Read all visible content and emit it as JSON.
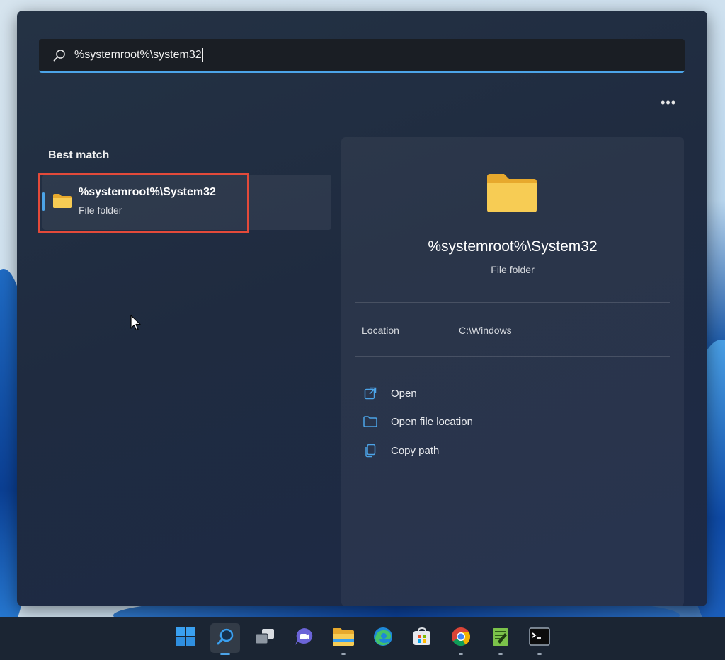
{
  "search": {
    "query": "%systemroot%\\system32",
    "icon": "search-icon"
  },
  "more_button": "•••",
  "best_match": {
    "heading": "Best match",
    "title": "%systemroot%\\System32",
    "subtitle": "File folder",
    "icon": "folder-icon"
  },
  "detail": {
    "title": "%systemroot%\\System32",
    "subtitle": "File folder",
    "location_label": "Location",
    "location_value": "C:\\Windows",
    "actions": [
      {
        "label": "Open",
        "icon": "open-external-icon"
      },
      {
        "label": "Open file location",
        "icon": "folder-outline-icon"
      },
      {
        "label": "Copy path",
        "icon": "copy-icon"
      }
    ]
  },
  "taskbar": {
    "items": [
      {
        "name": "start",
        "icon": "windows-logo-icon"
      },
      {
        "name": "search",
        "icon": "search-icon",
        "active": true
      },
      {
        "name": "task-view",
        "icon": "task-view-icon"
      },
      {
        "name": "teams-chat",
        "icon": "chat-icon"
      },
      {
        "name": "file-explorer",
        "icon": "file-explorer-icon"
      },
      {
        "name": "edge",
        "icon": "edge-icon"
      },
      {
        "name": "microsoft-store",
        "icon": "store-icon"
      },
      {
        "name": "chrome",
        "icon": "chrome-icon"
      },
      {
        "name": "notepad-plus-plus",
        "icon": "notepad-plus-plus-icon"
      },
      {
        "name": "terminal",
        "icon": "terminal-icon"
      }
    ]
  },
  "colors": {
    "accent": "#4ca4e8",
    "highlight_border": "#e34a3a",
    "folder": "#f5c44c"
  }
}
